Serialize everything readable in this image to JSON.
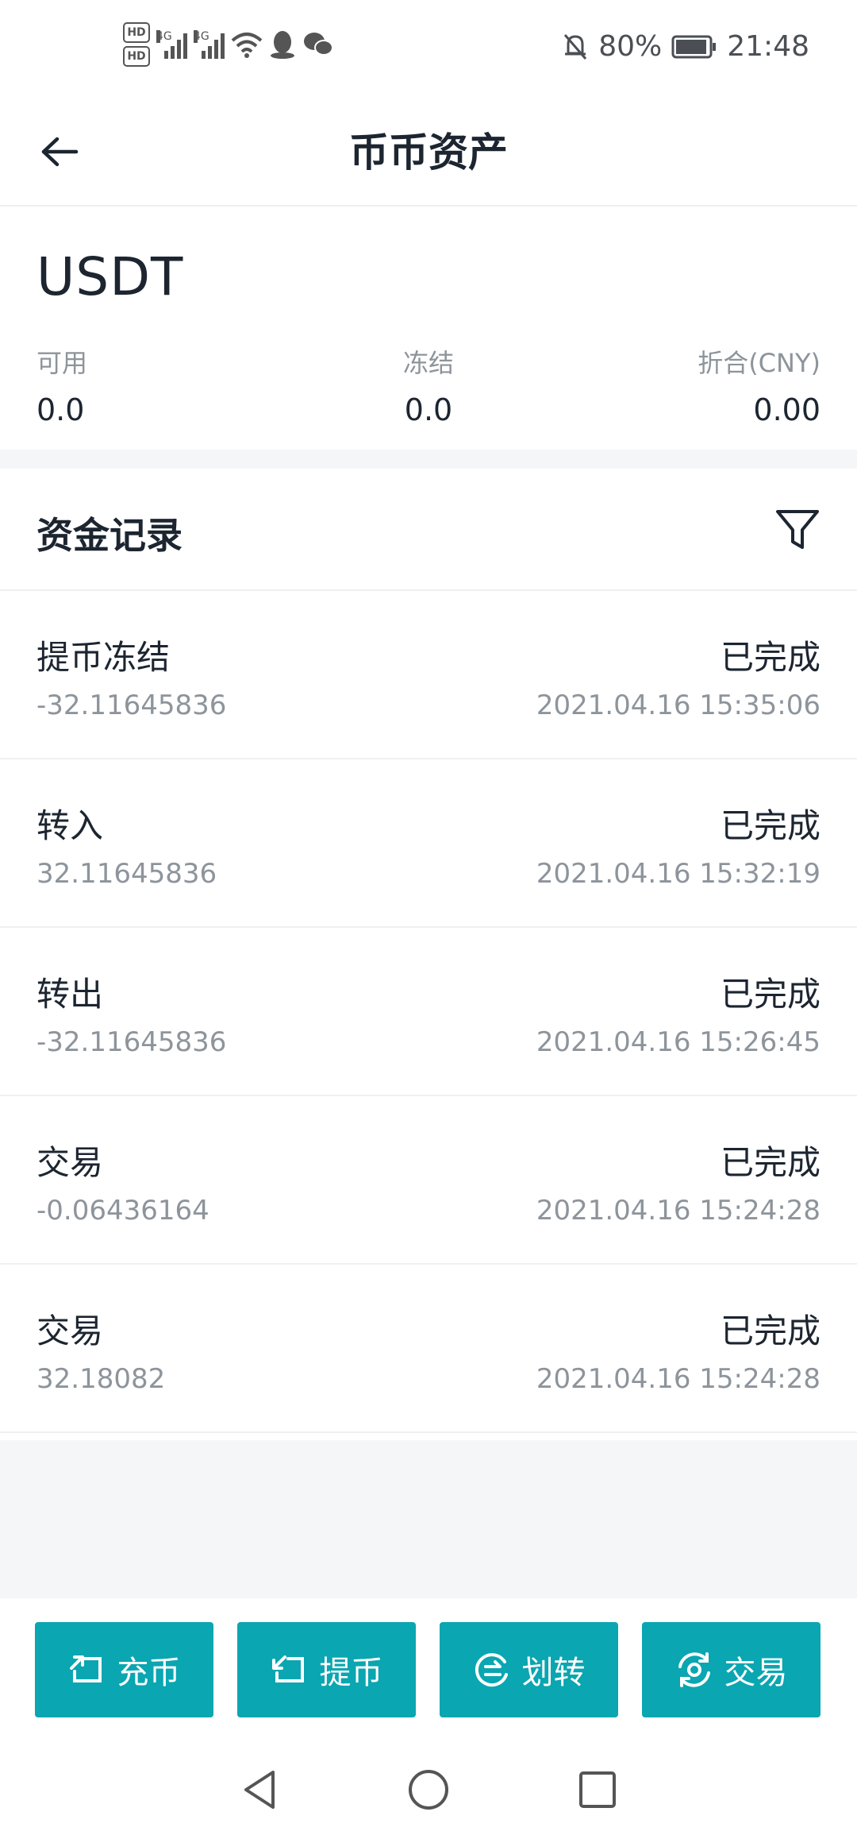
{
  "status_bar": {
    "hd1": "HD",
    "hd2": "HD",
    "net1": "4G",
    "net2": "4G",
    "battery": "80%",
    "time": "21:48"
  },
  "header": {
    "title": "币币资产"
  },
  "asset": {
    "name": "USDT",
    "available_label": "可用",
    "available_value": "0.0",
    "frozen_label": "冻结",
    "frozen_value": "0.0",
    "cny_label": "折合(CNY)",
    "cny_value": "0.00"
  },
  "records": {
    "title": "资金记录",
    "items": [
      {
        "type": "提币冻结",
        "amount": "-32.11645836",
        "status": "已完成",
        "time": "2021.04.16 15:35:06"
      },
      {
        "type": "转入",
        "amount": "32.11645836",
        "status": "已完成",
        "time": "2021.04.16 15:32:19"
      },
      {
        "type": "转出",
        "amount": "-32.11645836",
        "status": "已完成",
        "time": "2021.04.16 15:26:45"
      },
      {
        "type": "交易",
        "amount": "-0.06436164",
        "status": "已完成",
        "time": "2021.04.16 15:24:28"
      },
      {
        "type": "交易",
        "amount": "32.18082",
        "status": "已完成",
        "time": "2021.04.16 15:24:28"
      }
    ]
  },
  "actions": {
    "deposit": "充币",
    "withdraw": "提币",
    "transfer": "划转",
    "trade": "交易"
  },
  "colors": {
    "accent": "#0aa6b1",
    "text": "#1c2530",
    "muted": "#8d949b",
    "background": "#f4f6f8"
  }
}
